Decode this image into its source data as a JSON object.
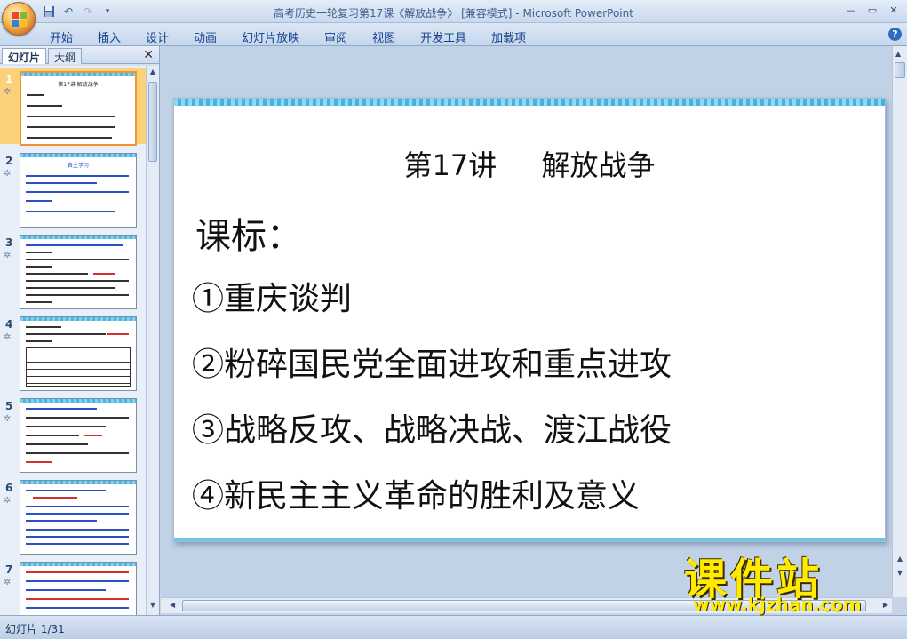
{
  "window": {
    "title": "高考历史一轮复习第17课《解放战争》 [兼容模式] - ",
    "app_name": "Microsoft PowerPoint"
  },
  "quick_access": {
    "save_icon": "save-icon",
    "undo_icon": "undo-icon",
    "redo_icon": "redo-icon",
    "customize_icon": "chevron-down-icon"
  },
  "ribbon": {
    "tabs": [
      "开始",
      "插入",
      "设计",
      "动画",
      "幻灯片放映",
      "审阅",
      "视图",
      "开发工具",
      "加载项"
    ]
  },
  "pane": {
    "tab_slides": "幻灯片",
    "tab_outline": "大纲",
    "close": "✕",
    "thumbnails": [
      {
        "num": "1",
        "title": "第17讲  解放战争",
        "selected": true
      },
      {
        "num": "2",
        "title": "自主学习",
        "selected": false
      },
      {
        "num": "3",
        "title": "",
        "selected": false
      },
      {
        "num": "4",
        "title": "",
        "selected": false
      },
      {
        "num": "5",
        "title": "",
        "selected": false
      },
      {
        "num": "6",
        "title": "",
        "selected": false
      },
      {
        "num": "7",
        "title": "",
        "selected": false
      }
    ]
  },
  "slide": {
    "title": "第17讲 解放战争",
    "heading": "课标：",
    "items": [
      "①重庆谈判",
      "②粉碎国民党全面进攻和重点进攻",
      "③战略反攻、战略决战、渡江战役",
      "④新民主主义革命的胜利及意义"
    ]
  },
  "status": {
    "slide_indicator": "幻灯片 1/31"
  },
  "watermark": {
    "main": "课件站",
    "url": "www.kjzhan.com"
  },
  "colors": {
    "accent_band": "#43b3e2",
    "selection": "#fbd27a",
    "watermark": "#ffea00"
  }
}
